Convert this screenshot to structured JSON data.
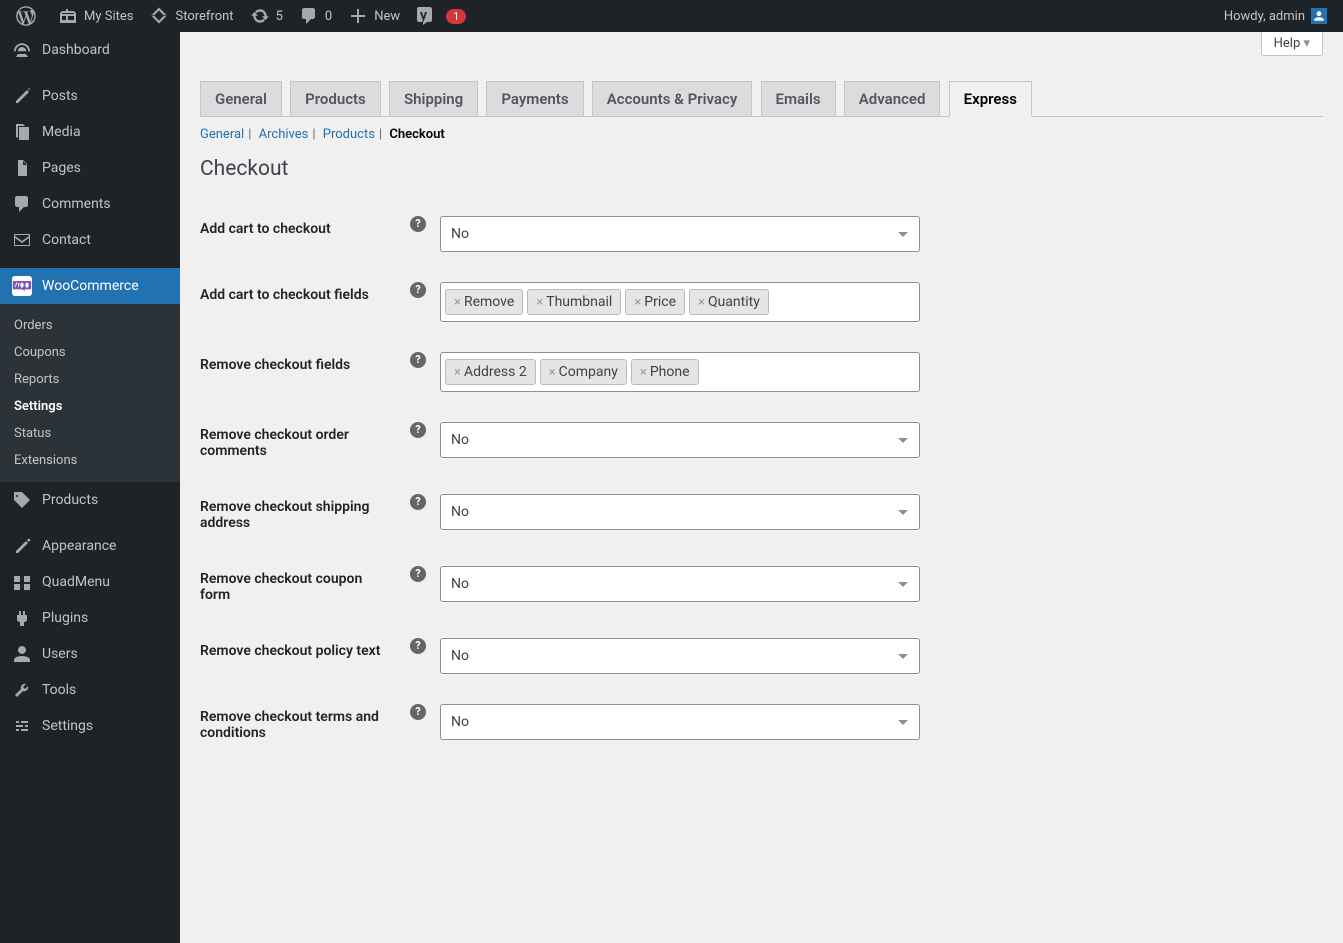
{
  "adminbar": {
    "mysites": "My Sites",
    "sitename": "Storefront",
    "updates_count": "5",
    "comments_count": "0",
    "new": "New",
    "yoast_count": "1",
    "greeting": "Howdy, admin"
  },
  "sidebar": {
    "dashboard": "Dashboard",
    "posts": "Posts",
    "media": "Media",
    "pages": "Pages",
    "comments": "Comments",
    "contact": "Contact",
    "woocommerce": "WooCommerce",
    "wc_sub": {
      "orders": "Orders",
      "coupons": "Coupons",
      "reports": "Reports",
      "settings": "Settings",
      "status": "Status",
      "extensions": "Extensions"
    },
    "products": "Products",
    "appearance": "Appearance",
    "quadmenu": "QuadMenu",
    "plugins": "Plugins",
    "users": "Users",
    "tools": "Tools",
    "settings": "Settings"
  },
  "help_label": "Help",
  "tabs": {
    "general": "General",
    "products": "Products",
    "shipping": "Shipping",
    "payments": "Payments",
    "accounts": "Accounts & Privacy",
    "emails": "Emails",
    "advanced": "Advanced",
    "express": "Express"
  },
  "subtabs": {
    "general": "General",
    "archives": "Archives",
    "products": "Products",
    "checkout": "Checkout"
  },
  "section_title": "Checkout",
  "fields": {
    "add_cart": {
      "label": "Add cart to checkout",
      "value": "No"
    },
    "add_cart_fields": {
      "label": "Add cart to checkout fields",
      "chips": [
        "Remove",
        "Thumbnail",
        "Price",
        "Quantity"
      ]
    },
    "remove_fields": {
      "label": "Remove checkout fields",
      "chips": [
        "Address 2",
        "Company",
        "Phone"
      ]
    },
    "remove_comments": {
      "label": "Remove checkout order comments",
      "value": "No"
    },
    "remove_shipping": {
      "label": "Remove checkout shipping address",
      "value": "No"
    },
    "remove_coupon": {
      "label": "Remove checkout coupon form",
      "value": "No"
    },
    "remove_policy": {
      "label": "Remove checkout policy text",
      "value": "No"
    },
    "remove_terms": {
      "label": "Remove checkout terms and conditions",
      "value": "No"
    }
  }
}
